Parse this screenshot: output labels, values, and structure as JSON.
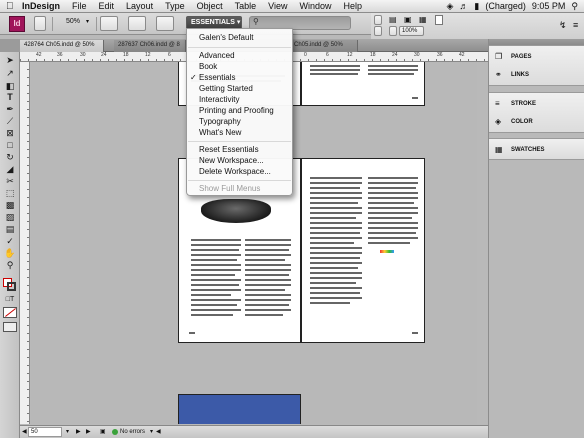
{
  "menubar": {
    "apple": "",
    "app": "InDesign",
    "items": [
      "File",
      "Edit",
      "Layout",
      "Type",
      "Object",
      "Table",
      "View",
      "Window",
      "Help"
    ],
    "battery": "(Charged)",
    "clock": "9:05 PM"
  },
  "appbar": {
    "logo": "Id",
    "zoom": "50%",
    "workspace_button": "ESSENTIALS ▾",
    "search_placeholder": ""
  },
  "control_strip": {
    "percent": "100%"
  },
  "tabs": [
    {
      "label": "428764 Ch05.indd @ 50%",
      "active": true
    },
    {
      "label": "287637 Ch06.indd @ 8",
      "active": false
    },
    {
      "label": "Ch05.indd @ 50%",
      "active": false
    }
  ],
  "ruler_numbers": [
    "42",
    "36",
    "30",
    "24",
    "18",
    "12",
    "6",
    "0",
    "6",
    "12",
    "18",
    "24",
    "30",
    "36",
    "42"
  ],
  "workspace_menu": {
    "header": "Galen's Default",
    "items": [
      "Advanced",
      "Book",
      "Essentials",
      "Getting Started",
      "Interactivity",
      "Printing and Proofing",
      "Typography",
      "What's New"
    ],
    "checked": "Essentials",
    "actions": [
      "Reset Essentials",
      "New Workspace...",
      "Delete Workspace..."
    ],
    "disabled_item": "Show Full Menus"
  },
  "panels": {
    "group1": [
      "PAGES",
      "LINKS"
    ],
    "group2": [
      "STROKE",
      "COLOR"
    ],
    "group3": [
      "SWATCHES"
    ]
  },
  "status": {
    "page": "50",
    "errors": "No errors"
  },
  "colors": {
    "blue_page": "#3c5aa8",
    "logo_bg": "#a0145a",
    "error_dot": "#3aa23a"
  }
}
